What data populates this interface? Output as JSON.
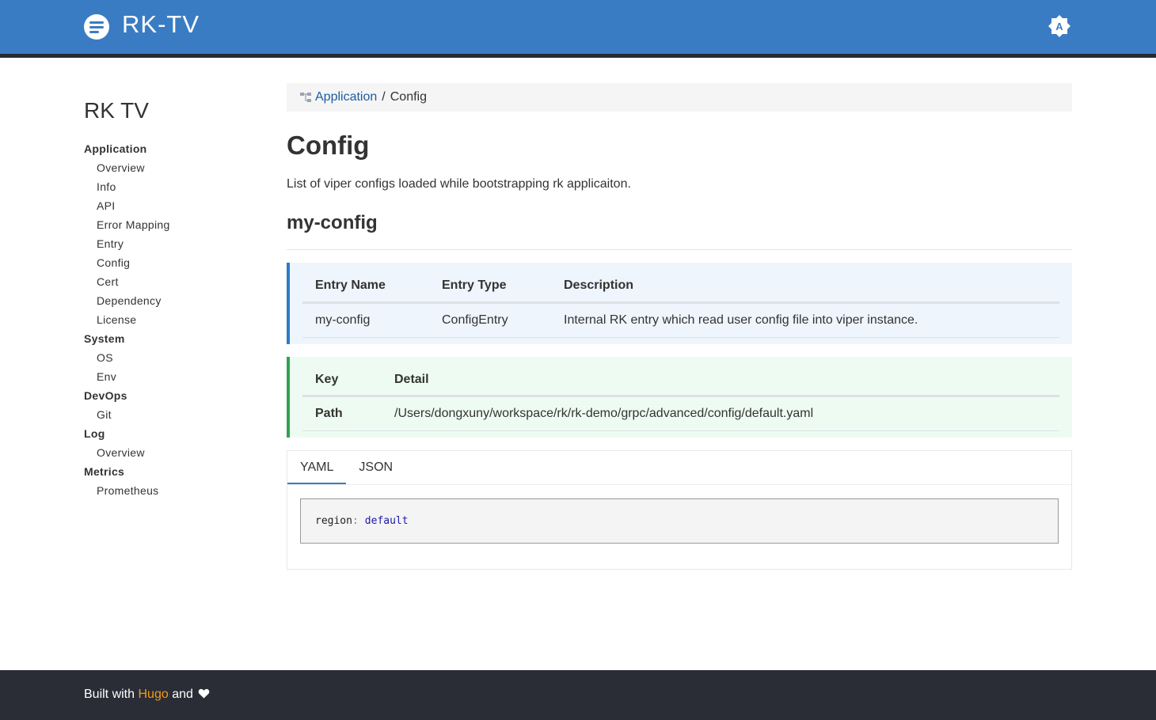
{
  "header": {
    "brand": "RK-TV",
    "theme_toggle_letter": "A",
    "bg_color": "#3a7cc3"
  },
  "sidebar": {
    "title": "RK TV",
    "sections": [
      {
        "label": "Application",
        "items": [
          "Overview",
          "Info",
          "API",
          "Error Mapping",
          "Entry",
          "Config",
          "Cert",
          "Dependency",
          "License"
        ]
      },
      {
        "label": "System",
        "items": [
          "OS",
          "Env"
        ]
      },
      {
        "label": "DevOps",
        "items": [
          "Git"
        ]
      },
      {
        "label": "Log",
        "items": [
          "Overview"
        ]
      },
      {
        "label": "Metrics",
        "items": [
          "Prometheus"
        ]
      }
    ]
  },
  "breadcrumb": {
    "icon": "sitemap-icon",
    "parent": "Application",
    "separator": "/",
    "current": "Config"
  },
  "page": {
    "title": "Config",
    "description": "List of viper configs loaded while bootstrapping rk applicaiton.",
    "section_title": "my-config"
  },
  "entry_table": {
    "headers": [
      "Entry Name",
      "Entry Type",
      "Description"
    ],
    "row": [
      "my-config",
      "ConfigEntry",
      "Internal RK entry which read user config file into viper instance."
    ]
  },
  "detail_table": {
    "headers": [
      "Key",
      "Detail"
    ],
    "row": [
      "Path",
      "/Users/dongxuny/workspace/rk/rk-demo/grpc/advanced/config/default.yaml"
    ]
  },
  "tabs": {
    "items": [
      "YAML",
      "JSON"
    ],
    "active": "YAML"
  },
  "code": {
    "key": "region",
    "colon": ":",
    "value": "default"
  },
  "footer": {
    "prefix": "Built with",
    "link": "Hugo",
    "suffix": "and",
    "icon": "heart-icon"
  }
}
